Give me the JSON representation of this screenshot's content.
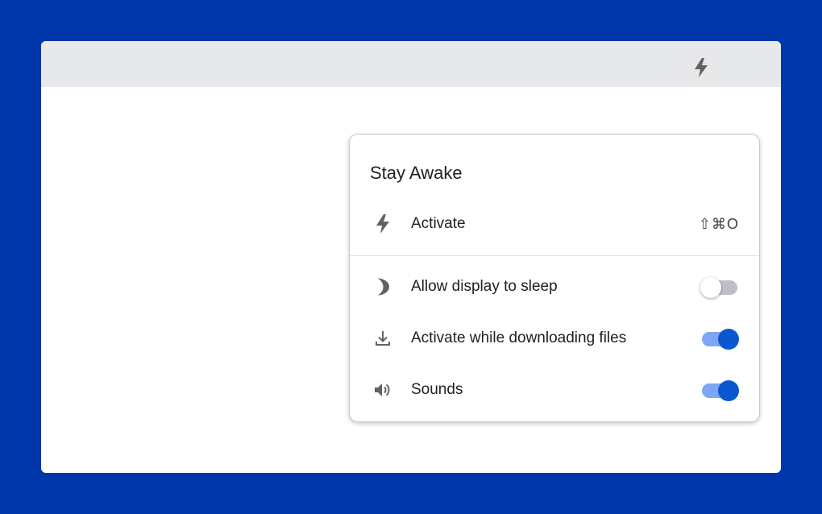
{
  "extension_button": {
    "icon": "bolt-icon"
  },
  "popup": {
    "title": "Stay Awake",
    "activate": {
      "label": "Activate",
      "shortcut": "⇧⌘O",
      "icon": "bolt-icon"
    },
    "settings": [
      {
        "label": "Allow display to sleep",
        "icon": "moon-icon",
        "enabled": false
      },
      {
        "label": "Activate while downloading files",
        "icon": "download-icon",
        "enabled": true
      },
      {
        "label": "Sounds",
        "icon": "speaker-icon",
        "enabled": true
      }
    ]
  },
  "colors": {
    "background": "#0037ab",
    "toggle_on": "#0b57d0",
    "toggle_on_track": "#7fa6f5",
    "toggle_off_track": "#bdc1c6"
  }
}
